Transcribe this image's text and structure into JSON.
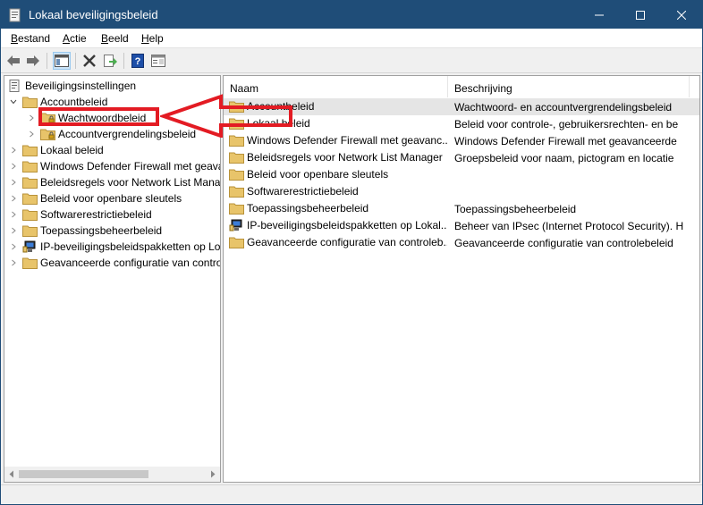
{
  "window": {
    "title": "Lokaal beveiligingsbeleid",
    "controls": {
      "minimize": "minimize-icon",
      "maximize": "maximize-icon",
      "close": "close-icon"
    }
  },
  "menu": [
    "Bestand",
    "Actie",
    "Beeld",
    "Help"
  ],
  "toolbar": [
    "back-arrow-icon",
    "forward-arrow-icon",
    "show-hide-tree-icon",
    "delete-icon",
    "export-list-icon",
    "help-icon",
    "properties-icon"
  ],
  "tree": {
    "root": "Beveiligingsinstellingen",
    "items": [
      {
        "label": "Accountbeleid",
        "expanded": true,
        "children": [
          {
            "label": "Wachtwoordbeleid",
            "highlighted": true
          },
          {
            "label": "Accountvergrendelingsbeleid"
          }
        ]
      },
      {
        "label": "Lokaal beleid"
      },
      {
        "label": "Windows Defender Firewall met geava"
      },
      {
        "label": "Beleidsregels voor Network List Mana"
      },
      {
        "label": "Beleid voor openbare sleutels"
      },
      {
        "label": "Softwarerestrictiebeleid"
      },
      {
        "label": "Toepassingsbeheerbeleid"
      },
      {
        "label": "IP-beveiligingsbeleidspakketten op Lo"
      },
      {
        "label": "Geavanceerde configuratie van contro"
      }
    ]
  },
  "list": {
    "columns": [
      "Naam",
      "Beschrijving"
    ],
    "rows": [
      {
        "name": "Accountbeleid",
        "description": "Wachtwoord- en accountvergrendelingsbeleid",
        "icon": "folder-icon"
      },
      {
        "name": "Lokaal beleid",
        "description": "Beleid voor controle-, gebruikersrechten- en be",
        "icon": "folder-icon"
      },
      {
        "name": "Windows Defender Firewall met geavanc...",
        "description": "Windows Defender Firewall met geavanceerde",
        "icon": "folder-icon"
      },
      {
        "name": "Beleidsregels voor Network List Manager",
        "description": "Groepsbeleid voor naam, pictogram en locatie",
        "icon": "folder-icon"
      },
      {
        "name": "Beleid voor openbare sleutels",
        "description": "",
        "icon": "folder-icon"
      },
      {
        "name": "Softwarerestrictiebeleid",
        "description": "",
        "icon": "folder-icon"
      },
      {
        "name": "Toepassingsbeheerbeleid",
        "description": "Toepassingsbeheerbeleid",
        "icon": "folder-icon"
      },
      {
        "name": "IP-beveiligingsbeleidspakketten op Lokal...",
        "description": "Beheer van IPsec (Internet Protocol Security). H",
        "icon": "ip-security-icon"
      },
      {
        "name": "Geavanceerde configuratie van controleb...",
        "description": "Geavanceerde configuratie van controlebeleid",
        "icon": "folder-icon"
      }
    ]
  },
  "colors": {
    "titlebar": "#1f4d78",
    "annotation": "#e31b23",
    "folder": "#e8c46a"
  }
}
